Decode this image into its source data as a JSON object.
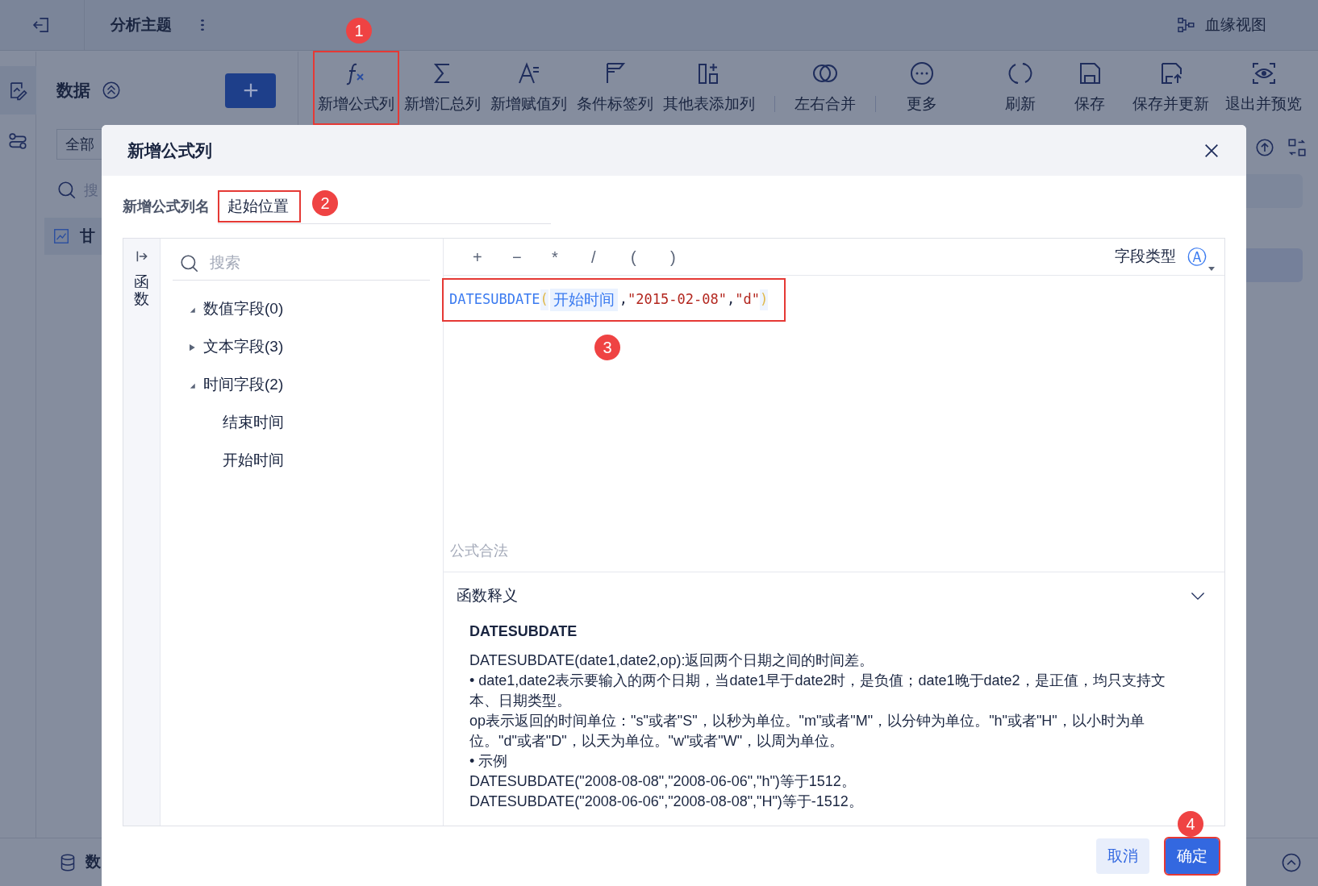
{
  "app_bar": {
    "title": "分析主题",
    "lineage_label": "血缘视图"
  },
  "data_panel": {
    "title": "数据",
    "filter_value": "全部",
    "search_placeholder": "搜",
    "item_label": "甘"
  },
  "toolbar": [
    {
      "label": "新增公式列",
      "outlined": true,
      "callout": "1",
      "divider_after": false
    },
    {
      "label": "新增汇总列",
      "outlined": false,
      "divider_after": false
    },
    {
      "label": "新增赋值列",
      "outlined": false,
      "divider_after": false
    },
    {
      "label": "条件标签列",
      "outlined": false,
      "divider_after": false
    },
    {
      "label": "其他表添加列",
      "outlined": false,
      "divider_after": true
    },
    {
      "label": "左右合并",
      "outlined": false,
      "divider_after": true
    },
    {
      "label": "更多",
      "outlined": false,
      "divider_after": false
    },
    {
      "label": "刷新",
      "outlined": false,
      "divider_after": false
    },
    {
      "label": "保存",
      "outlined": false,
      "divider_after": false
    },
    {
      "label": "保存并更新",
      "outlined": false,
      "divider_after": false
    },
    {
      "label": "退出并预览",
      "outlined": false,
      "divider_after": false
    }
  ],
  "bottom_bar": {
    "label": "数"
  },
  "dialog": {
    "title": "新增公式列",
    "name_field": {
      "label": "新增公式列名",
      "value": "起始位置",
      "outlined": true,
      "callout": "2"
    },
    "side_tab": "函数",
    "search_placeholder": "搜索",
    "field_groups": [
      {
        "label": "数值字段(0)",
        "expanded": true
      },
      {
        "label": "文本字段(3)",
        "expanded": false
      },
      {
        "label": "时间字段(2)",
        "expanded": true,
        "children": [
          {
            "label": "结束时间"
          },
          {
            "label": "开始时间"
          }
        ]
      }
    ],
    "operators": [
      "+",
      "−",
      "*",
      "/",
      "(",
      ")"
    ],
    "field_type_label": "字段类型",
    "field_type_glyph": "Ⓐ",
    "formula": {
      "outlined": true,
      "callout": "3",
      "tokens": [
        {
          "kind": "function",
          "text": "DATESUBDATE"
        },
        {
          "kind": "paren",
          "text": "("
        },
        {
          "kind": "field",
          "text": "开始时间"
        },
        {
          "kind": "punct",
          "text": ","
        },
        {
          "kind": "string",
          "text": "\"2015-02-08\""
        },
        {
          "kind": "punct",
          "text": ","
        },
        {
          "kind": "string",
          "text": "\"d\""
        },
        {
          "kind": "paren",
          "text": ")"
        }
      ]
    },
    "status": "公式合法",
    "help": {
      "title": "函数释义",
      "expanded": true,
      "name": "DATESUBDATE",
      "lines": [
        "DATESUBDATE(date1,date2,op):返回两个日期之间的时间差。",
        "• date1,date2表示要输入的两个日期，当date1早于date2时，是负值；date1晚于date2，是正值，均只支持文本、日期类型。",
        "op表示返回的时间单位：\"s\"或者\"S\"，以秒为单位。\"m\"或者\"M\"，以分钟为单位。\"h\"或者\"H\"，以小时为单位。\"d\"或者\"D\"，以天为单位。\"w\"或者\"W\"，以周为单位。",
        "• 示例",
        "DATESUBDATE(\"2008-08-08\",\"2008-06-06\",\"h\")等于1512。",
        "DATESUBDATE(\"2008-06-06\",\"2008-08-08\",\"H\")等于-1512。"
      ]
    },
    "buttons": [
      {
        "label": "取消",
        "kind": "secondary"
      },
      {
        "label": "确定",
        "kind": "primary",
        "outlined": true,
        "callout": "4"
      }
    ]
  }
}
